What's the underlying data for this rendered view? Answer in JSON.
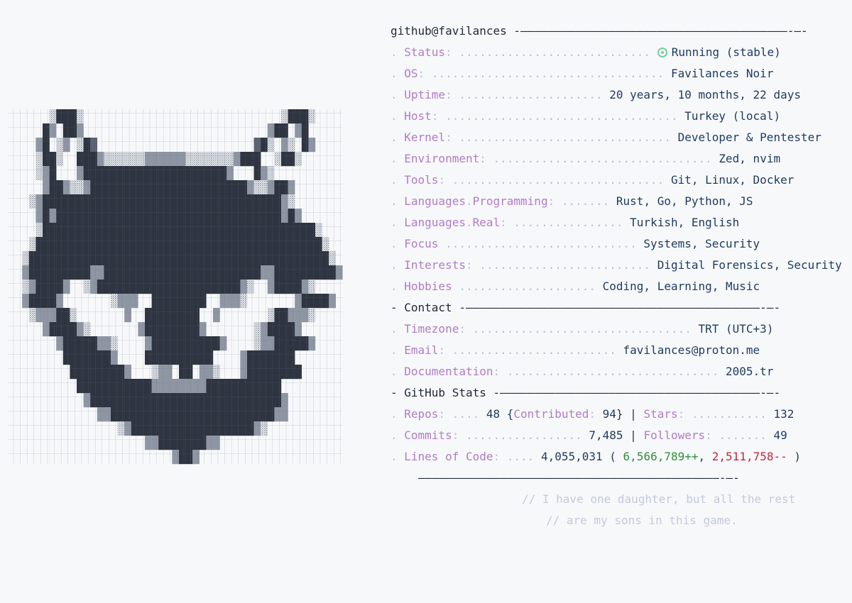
{
  "header": {
    "title": "github@favilances",
    "rule": " -———————————————————————————————————————-—-"
  },
  "rows": [
    {
      "key": "Status",
      "dots": ": ............................ ",
      "status_icon": "status-indicator-icon",
      "value": "Running (stable)"
    },
    {
      "key": "OS",
      "dots": ": .................................. ",
      "value": "Favilances Noir"
    },
    {
      "key": "Uptime",
      "dots": ": ..................... ",
      "value": "20 years, 10 months, 22 days"
    },
    {
      "key": "Host",
      "dots": ": .................................. ",
      "value": "Turkey (local)"
    },
    {
      "key": "Kernel",
      "dots": ": ............................... ",
      "value": "Developer & Pentester"
    },
    {
      "key": "Environment",
      "dots": ": ................................ ",
      "value": "Zed, nvim"
    },
    {
      "key": "Tools",
      "dots": ": ............................... ",
      "value": "Git, Linux, Docker"
    },
    {
      "key": "Languages",
      "key2": "Programming",
      "dots": ": ....... ",
      "value": "Rust, Go, Python, JS"
    },
    {
      "key": "Languages",
      "key2": "Real",
      "dots": ": ................ ",
      "value": "Turkish, English"
    },
    {
      "key": "Focus",
      "dots": " ............................ ",
      "value": "Systems, Security"
    },
    {
      "key": "Interests",
      "dots": ": ......................... ",
      "value": "Digital Forensics, Security"
    },
    {
      "key": "Hobbies",
      "dots": " .................... ",
      "value": "Coding, Learning, Music"
    }
  ],
  "contact": {
    "title": "Contact",
    "rule": " -———————————————————————————————————————————-—-",
    "rows": [
      {
        "key": "Timezone",
        "dots": ": ................................ ",
        "value": "TRT (UTC+3)"
      },
      {
        "key": "Email",
        "dots": ": ........................ ",
        "value": "favilances@proton.me"
      },
      {
        "key": "Documentation",
        "dots": ": ............................... ",
        "value": "2005.tr"
      }
    ]
  },
  "stats": {
    "title": "GitHub Stats",
    "rule": " -——————————————————————————————————————-—-",
    "repos_label": "Repos",
    "repos_dots": ": .... ",
    "repos": "48",
    "contributed_label": "Contributed",
    "contributed": "94",
    "stars_label": "Stars",
    "stars_dots": ": ........... ",
    "stars": "132",
    "commits_label": "Commits",
    "commits_dots": ": ................. ",
    "commits": "7,485",
    "followers_label": "Followers",
    "followers_dots": ": ....... ",
    "followers": "49",
    "loc_label": "Lines of Code",
    "loc_dots": ": .... ",
    "loc": "4,055,031",
    "added": "6,566,789++",
    "removed": "2,511,758--"
  },
  "footer": {
    "rule": "————————————————————————————————————————————-—-",
    "comment1": "// I have one daughter, but all the rest",
    "comment2": "// are my sons in this game."
  },
  "art": {
    "name": "fox-mask-ascii-art",
    "color": "#2e3440"
  }
}
